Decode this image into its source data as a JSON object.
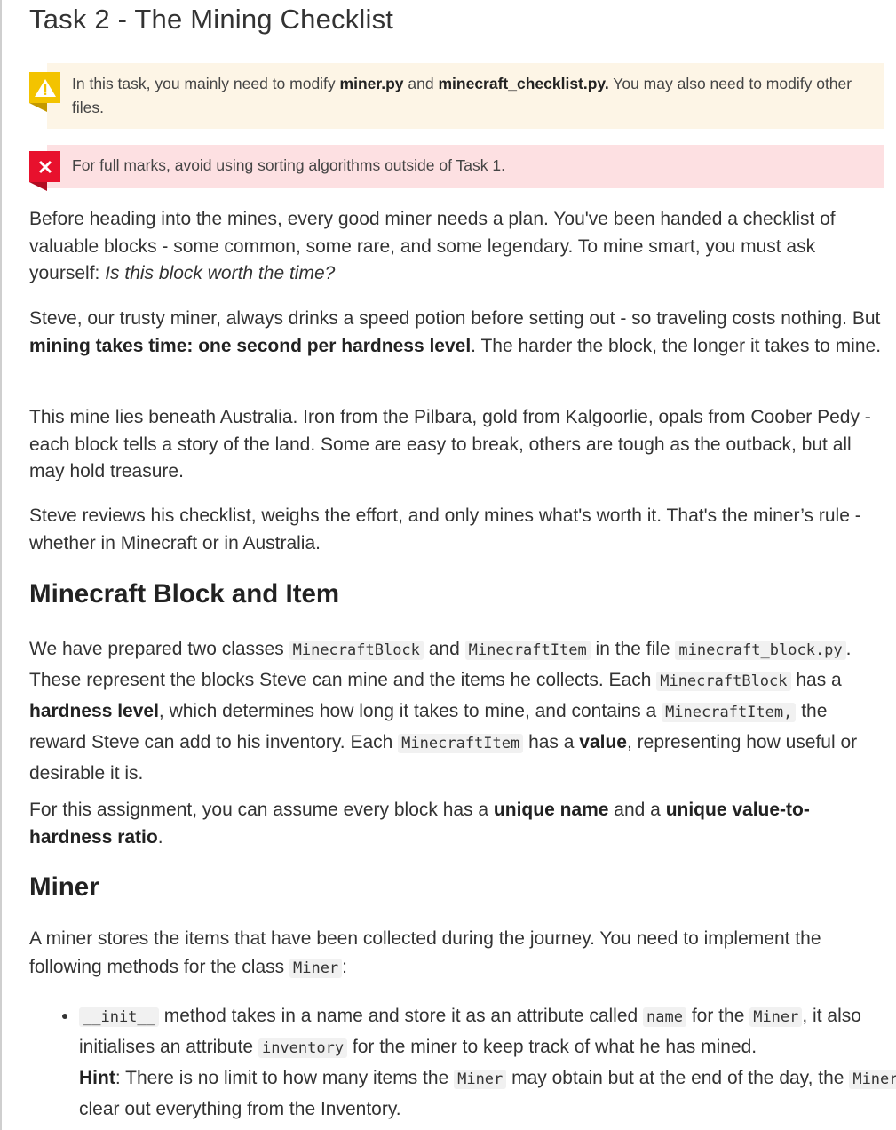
{
  "title": "Task 2 - The Mining Checklist",
  "warning": {
    "text_1": "In this task, you mainly need to modify ",
    "file_1": "miner.py",
    "text_2": " and ",
    "file_2": "minecraft_checklist.py.",
    "text_3": " You may also need to modify other files."
  },
  "error": {
    "text": "For full marks, avoid using sorting algorithms outside of Task 1."
  },
  "intro": {
    "p1_a": "Before heading into the mines, every good miner needs a plan. You've been handed a checklist of valuable blocks - some common, some rare, and some legendary. To mine smart, you must ask yourself: ",
    "p1_em": "Is this block worth the time?",
    "p2_a": "Steve, our trusty miner, always drinks a speed potion before setting out - so traveling costs nothing. But ",
    "p2_b": "mining takes time: one second per hardness level",
    "p2_c": ". The harder the block, the longer it takes to mine.",
    "p3": "This mine lies beneath Australia. Iron from the Pilbara, gold from Kalgoorlie, opals from Coober Pedy - each block tells a story of the land. Some are easy to break, others are tough as the outback, but all may hold treasure.",
    "p4": "Steve reviews his checklist, weighs the effort, and only mines what's worth it. That's the miner’s rule - whether in Minecraft or in Australia."
  },
  "section_block": {
    "heading": "Minecraft Block and Item",
    "p1_a": "We have prepared two classes ",
    "code_block": "MinecraftBlock",
    "p1_b": " and ",
    "code_item": "MinecraftItem",
    "p1_c": " in the file ",
    "code_file": "minecraft_block.py",
    "p1_d": ". These represent the blocks Steve can mine and the items he collects. Each ",
    "code_block_2": "MinecraftBlock",
    "p1_e": " has a ",
    "p1_bold_hardness": "hardness level",
    "p1_f": ", which determines how long it takes to mine, and contains a ",
    "code_item_2": "MinecraftItem,",
    "p1_g": " the reward Steve can add to his inventory. Each ",
    "code_item_3": "MinecraftItem",
    "p1_h": " has a ",
    "p1_bold_value": "value",
    "p1_i": ", representing how useful or desirable it is.",
    "p2_a": "For this assignment, you can assume every block has a ",
    "p2_bold_1": "unique name",
    "p2_b": " and a ",
    "p2_bold_2": "unique value-to-hardness ratio",
    "p2_c": "."
  },
  "section_miner": {
    "heading": "Miner",
    "p1_a": "A miner stores the items that have been collected during the journey. You need to implement the following methods for the class ",
    "code_miner": "Miner",
    "p1_b": ":",
    "bullet": {
      "code_init": "__init__",
      "t1": " method takes in a name and store it as an attribute called ",
      "code_name": "name",
      "t2": " for the ",
      "code_miner": "Miner",
      "t3": ", it also initialises an attribute ",
      "code_inventory": "inventory",
      "t4": " for the miner to keep track of what he has mined.",
      "hint_label": "Hint",
      "t5": ": There is no limit to how many items the ",
      "code_miner_2": "Miner",
      "t6": " may obtain but at the end of the day, the ",
      "code_miner_3": "Miner",
      "t7": " will clear out everything from the Inventory."
    }
  },
  "colors": {
    "warning_bg": "#fdf5e6",
    "warning_icon": "#f3c300",
    "error_bg": "#fde0e2",
    "error_icon": "#e8112d"
  },
  "icons": {
    "warning": "warning-triangle-icon",
    "error": "close-x-icon"
  }
}
